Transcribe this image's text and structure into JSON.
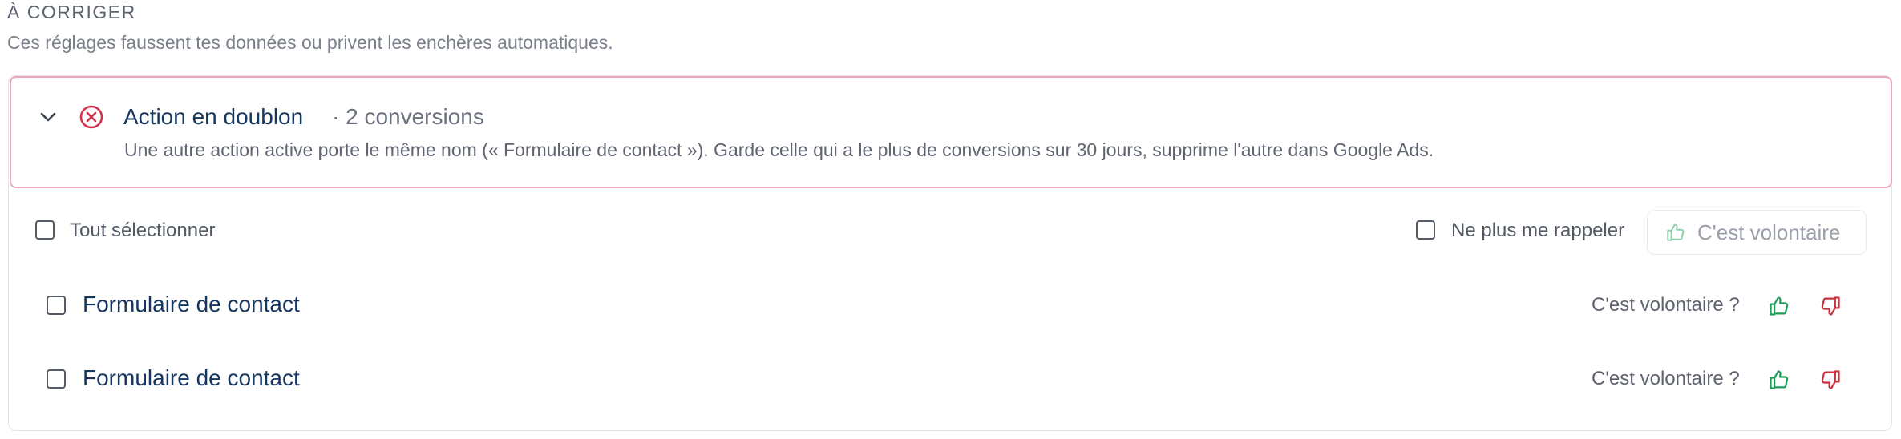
{
  "section": {
    "title": "À CORRIGER",
    "subtitle": "Ces réglages faussent tes données ou privent les enchères automatiques."
  },
  "issue": {
    "title": "Action en doublon",
    "count": "· 2 conversions",
    "description": "Une autre action active porte le même nom (« Formulaire de contact »). Garde celle qui a le plus de conversions sur 30 jours, supprime l'autre dans Google Ads.",
    "icon": "x-circle-icon",
    "status_color": "#d0344f",
    "border_color": "#eba8bd"
  },
  "toolbar": {
    "select_all_label": "Tout sélectionner",
    "remind_label": "Ne plus me rappeler",
    "volontaire_button": "C'est volontaire"
  },
  "rows": [
    {
      "label": "Formulaire de contact",
      "question": "C'est volontaire ?",
      "checked": false
    },
    {
      "label": "Formulaire de contact",
      "question": "C'est volontaire ?",
      "checked": false
    }
  ],
  "colors": {
    "thumb_up": "#1f9e5a",
    "thumb_down": "#c8323e",
    "title_text": "#14365f"
  }
}
